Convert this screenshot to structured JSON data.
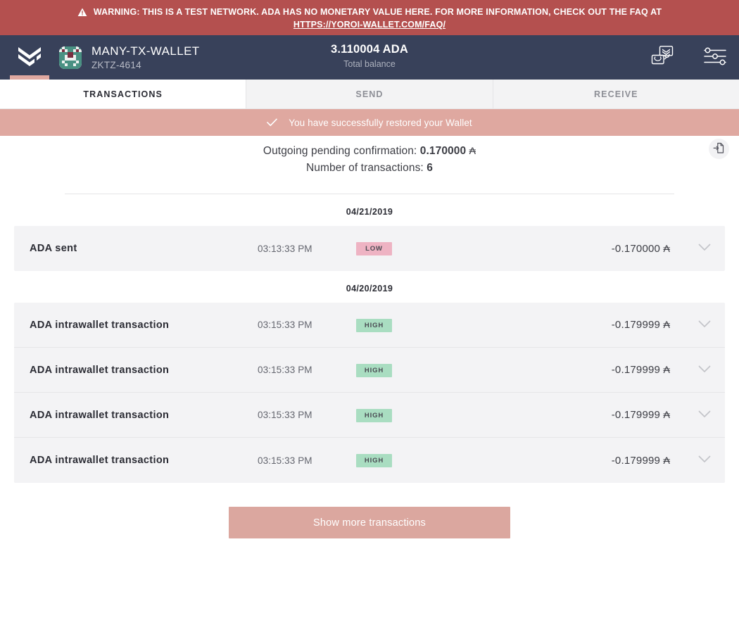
{
  "warning": {
    "icon": "warning-triangle-icon",
    "text": "WARNING: THIS IS A TEST NETWORK. ADA HAS NO MONETARY VALUE HERE. FOR MORE INFORMATION, CHECK OUT THE FAQ AT",
    "link": "HTTPS://YOROI-WALLET.COM/FAQ/",
    "background": "#b4504f"
  },
  "navbar": {
    "logo": "yoroi-logo-icon",
    "wallet_name": "MANY-TX-WALLET",
    "wallet_plate": "ZKTZ-4614",
    "balance_amount": "3.110004 ADA",
    "balance_label": "Total balance",
    "icons": [
      {
        "name": "switch-wallet-icon"
      },
      {
        "name": "settings-sliders-icon"
      }
    ],
    "background": "#38415a",
    "accent": "#dfa8a0"
  },
  "tabs": [
    {
      "label": "TRANSACTIONS",
      "active": true
    },
    {
      "label": "SEND",
      "active": false
    },
    {
      "label": "RECEIVE",
      "active": false
    }
  ],
  "notification": {
    "icon": "check-icon",
    "text": "You have successfully restored your Wallet",
    "background": "#dfa8a0"
  },
  "summary": {
    "pending_label": "Outgoing pending confirmation:",
    "pending_value": "0.170000",
    "pending_symbol": "₳",
    "count_label": "Number of transactions:",
    "count_value": "6",
    "export_icon": "export-file-icon"
  },
  "transactions": [
    {
      "date": "04/21/2019",
      "rows": [
        {
          "type": "ADA sent",
          "time": "03:13:33 PM",
          "status": "LOW",
          "status_level": "low",
          "amount": "-0.170000",
          "symbol": "₳",
          "chevron": "chevron-down-icon"
        }
      ]
    },
    {
      "date": "04/20/2019",
      "rows": [
        {
          "type": "ADA intrawallet transaction",
          "time": "03:15:33 PM",
          "status": "HIGH",
          "status_level": "high",
          "amount": "-0.179999",
          "symbol": "₳",
          "chevron": "chevron-down-icon"
        },
        {
          "type": "ADA intrawallet transaction",
          "time": "03:15:33 PM",
          "status": "HIGH",
          "status_level": "high",
          "amount": "-0.179999",
          "symbol": "₳",
          "chevron": "chevron-down-icon"
        },
        {
          "type": "ADA intrawallet transaction",
          "time": "03:15:33 PM",
          "status": "HIGH",
          "status_level": "high",
          "amount": "-0.179999",
          "symbol": "₳",
          "chevron": "chevron-down-icon"
        },
        {
          "type": "ADA intrawallet transaction",
          "time": "03:15:33 PM",
          "status": "HIGH",
          "status_level": "high",
          "amount": "-0.179999",
          "symbol": "₳",
          "chevron": "chevron-down-icon"
        }
      ]
    }
  ],
  "show_more": {
    "label": "Show more transactions",
    "background": "#dba79f"
  },
  "colors": {
    "badge_low": "#eeb3c3",
    "badge_high": "#a9ddc1",
    "navbar": "#38415a",
    "accent_pink": "#dfa8a0",
    "warning_red": "#b4504f",
    "row_bg": "#f3f3f5"
  }
}
